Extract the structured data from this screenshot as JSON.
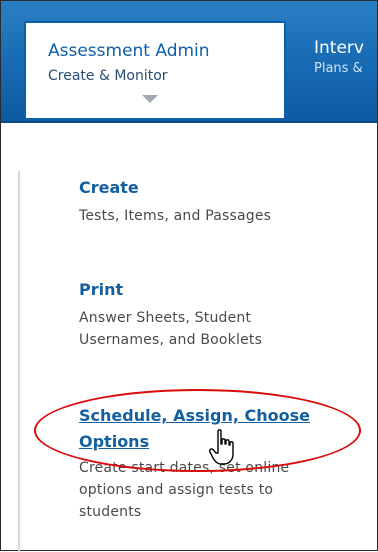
{
  "top_nav": {
    "active_tab": {
      "title": "Assessment Admin",
      "subtitle": "Create & Monitor"
    },
    "next_tab": {
      "title": "Interv",
      "subtitle": "Plans &"
    }
  },
  "sections": [
    {
      "title": "Create",
      "desc": "Tests, Items, and Passages"
    },
    {
      "title": "Print",
      "desc_lines": [
        "Answer Sheets, Student",
        "Usernames, and Booklets"
      ]
    },
    {
      "title_lines": [
        "Schedule, Assign, Choose",
        "Options"
      ],
      "desc_lines": [
        "Create start dates, set online",
        "options and assign tests to",
        "students"
      ]
    }
  ],
  "annotation": {
    "ellipse_color": "#d90b0b"
  },
  "icons": {
    "cursor": "hand-pointer-icon",
    "tab_chevron": "chevron-down-icon"
  }
}
